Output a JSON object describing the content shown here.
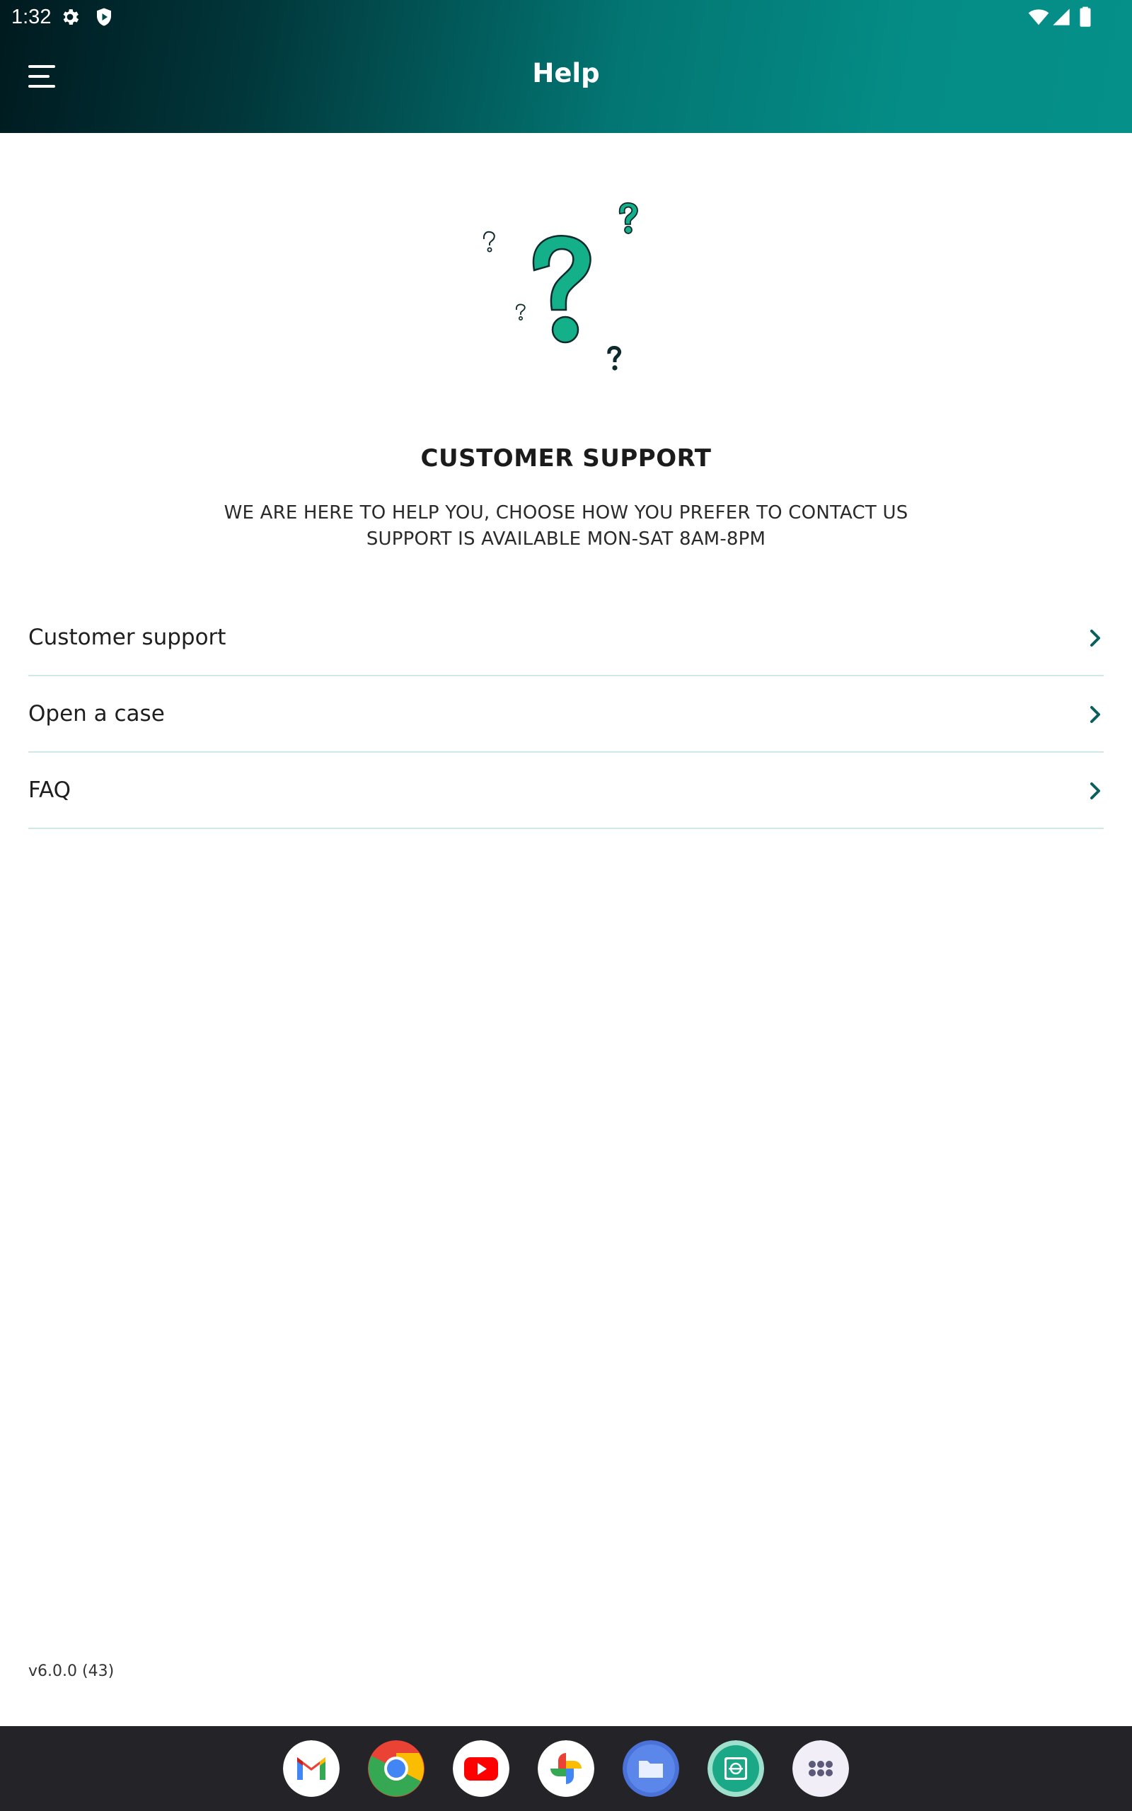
{
  "status_bar": {
    "time": "1:32",
    "icons": [
      "settings-icon",
      "shield-icon",
      "wifi-icon",
      "signal-icon",
      "battery-icon"
    ]
  },
  "app_bar": {
    "title": "Help",
    "menu_icon": "hamburger-menu-icon"
  },
  "illustration": {
    "icon": "question-marks-illustration",
    "accent_color": "#14b08a",
    "dark_color": "#0d2a2c"
  },
  "support": {
    "title": "CUSTOMER SUPPORT",
    "line1": "WE ARE HERE TO HELP YOU, CHOOSE HOW YOU PREFER TO CONTACT US",
    "line2": "SUPPORT IS AVAILABLE MON-SAT 8AM-8PM"
  },
  "menu_items": [
    {
      "label": "Customer support",
      "icon": "chevron-right-icon"
    },
    {
      "label": "Open a case",
      "icon": "chevron-right-icon"
    },
    {
      "label": "FAQ",
      "icon": "chevron-right-icon"
    }
  ],
  "version": "v6.0.0 (43)",
  "dock": {
    "apps": [
      "gmail-icon",
      "chrome-icon",
      "youtube-icon",
      "photos-icon",
      "files-icon",
      "app-icon",
      "app-drawer-icon"
    ]
  },
  "colors": {
    "header_start": "#001a1f",
    "header_end": "#05908a",
    "divider": "#cfe9e6",
    "chevron": "#0b5f5e",
    "dock_bg": "#232328"
  }
}
